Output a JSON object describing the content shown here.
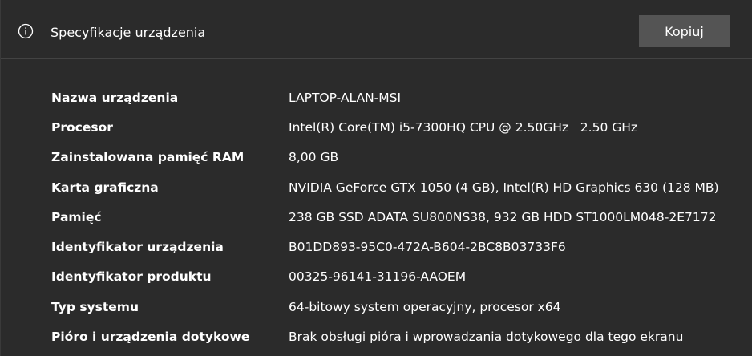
{
  "header": {
    "icon": "info-icon",
    "title": "Specyfikacje urządzenia",
    "copy_label": "Kopiuj"
  },
  "specs": [
    {
      "label": "Nazwa urządzenia",
      "value": "LAPTOP-ALAN-MSI"
    },
    {
      "label": "Procesor",
      "value": "Intel(R) Core(TM) i5-7300HQ CPU @ 2.50GHz   2.50 GHz"
    },
    {
      "label": "Zainstalowana pamięć RAM",
      "value": "8,00 GB"
    },
    {
      "label": "Karta graficzna",
      "value": "NVIDIA GeForce GTX 1050 (4 GB), Intel(R) HD Graphics 630 (128 MB)"
    },
    {
      "label": "Pamięć",
      "value": "238 GB SSD ADATA SU800NS38, 932 GB HDD ST1000LM048-2E7172"
    },
    {
      "label": "Identyfikator urządzenia",
      "value": "B01DD893-95C0-472A-B604-2BC8B03733F6"
    },
    {
      "label": "Identyfikator produktu",
      "value": "00325-96141-31196-AAOEM"
    },
    {
      "label": "Typ systemu",
      "value": "64-bitowy system operacyjny, procesor x64"
    },
    {
      "label": "Pióro i urządzenia dotykowe",
      "value": "Brak obsługi pióra i wprowadzania dotykowego dla tego ekranu"
    }
  ],
  "colors": {
    "background": "#2b2b2b",
    "button": "#545454",
    "divider": "#434343",
    "text": "#ffffff"
  }
}
